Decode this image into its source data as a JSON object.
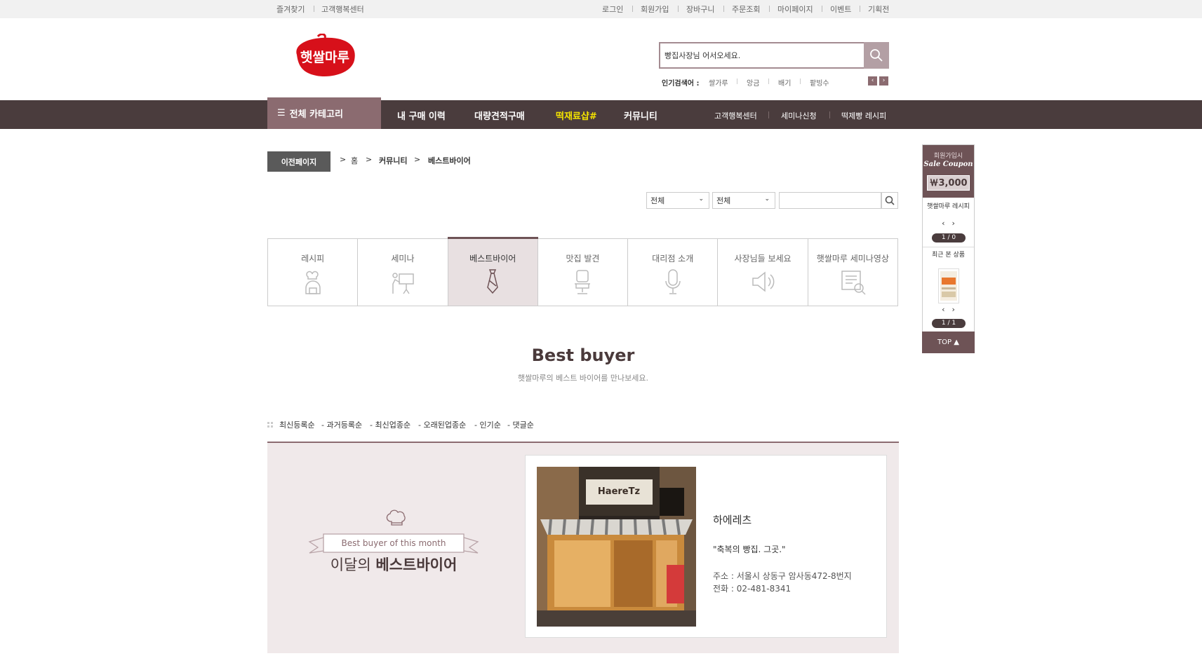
{
  "topbar": {
    "left": [
      "즐겨찾기",
      "고객행복센터"
    ],
    "right": [
      "로그인",
      "회원가입",
      "장바구니",
      "주문조회",
      "마이페이지",
      "이벤트",
      "기획전"
    ]
  },
  "logo": {
    "text": "햇쌀마루",
    "color": "#d7101a"
  },
  "search": {
    "value": "빵집사장님 어서오세요.",
    "popular_label": "인기검색어 :",
    "popular": [
      "쌀가루",
      "앙금",
      "배기",
      "팥빙수"
    ]
  },
  "nav": {
    "all_label": "전체 카테고리",
    "items": [
      "내 구매 이력",
      "대량견적구매",
      "떡재료샵#",
      "커뮤니티"
    ],
    "highlight_color": "#f5e400",
    "sub": [
      "고객행복센터",
      "세미나신청",
      "떡제빵 레시피"
    ]
  },
  "breadcrumb": {
    "prev": "이전페이지",
    "items": [
      "홈",
      "커뮤니티",
      "베스트바이어"
    ]
  },
  "filters": {
    "select1": "전체",
    "select2": "전체",
    "search_value": ""
  },
  "categories": [
    {
      "label": "레시피",
      "icon": "chef-icon"
    },
    {
      "label": "세미나",
      "icon": "presentation-icon"
    },
    {
      "label": "베스트바이어",
      "icon": "tie-icon",
      "active": true
    },
    {
      "label": "맛집 발견",
      "icon": "chair-icon"
    },
    {
      "label": "대리점 소개",
      "icon": "microphone-icon"
    },
    {
      "label": "사장님들 보세요",
      "icon": "speaker-icon"
    },
    {
      "label": "햇쌀마루 세미나영상",
      "icon": "video-doc-icon"
    }
  ],
  "heading": {
    "title": "Best buyer",
    "subtitle": "햇쌀마루의 베스트 바이어를 만나보세요."
  },
  "sort": [
    "최신등록순",
    "- 과거등록순",
    "- 최신업종순",
    "- 오래된업종순",
    "- 인기순",
    "- 댓글순"
  ],
  "feature": {
    "badge_en": "Best buyer of this month",
    "badge_ko_1": "이달의 ",
    "badge_ko_2": "베스트바이어",
    "shop_name": "하에레츠",
    "sign_text": "HaereTz",
    "quote": "\"축복의 빵집. 그곳.\"",
    "address": "주소 : 서울시 상동구 암사동472-8번지",
    "tel": "전화 : 02-481-8341"
  },
  "quick_menu": {
    "coupon_line1": "회원가입시",
    "coupon_line2": "Sale Coupon",
    "coupon_amount": "￦3,000",
    "recipe_label": "햇쌀마루 레시피",
    "recipe_page": "1 / 0",
    "recent_label": "최근 본 상품",
    "recent_page": "1 / 1",
    "top_label": "TOP ▲"
  }
}
